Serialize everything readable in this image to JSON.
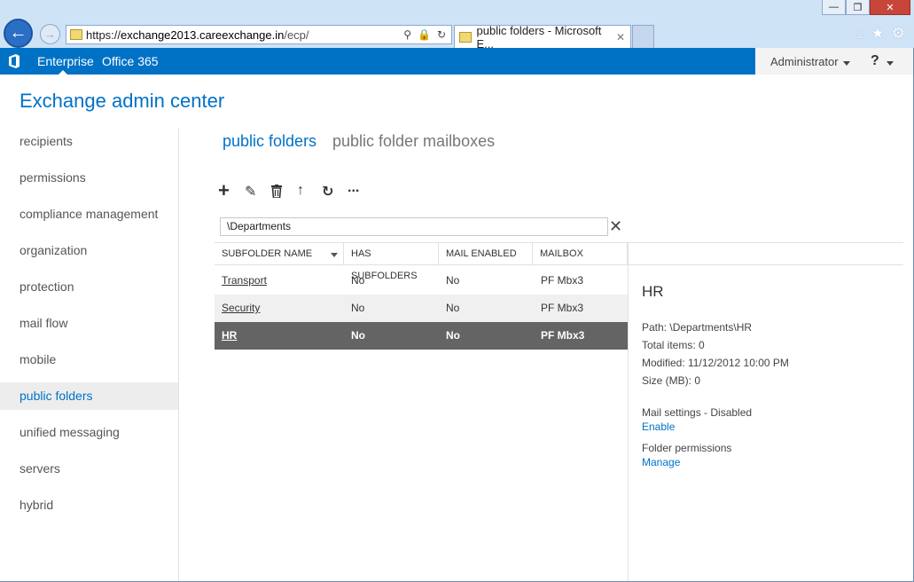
{
  "browser": {
    "window_buttons": {
      "minimize": "—",
      "restore": "❐",
      "close": "✕"
    },
    "address": {
      "host_prefix": "https://",
      "host": "exchange2013.careexchange.in",
      "path": "/ecp/"
    },
    "tab": {
      "title": "public folders - Microsoft E...",
      "close": "✕"
    },
    "toolbar_icons": [
      "home-icon",
      "star-icon",
      "gear-icon"
    ]
  },
  "suite": {
    "enterprise": "Enterprise",
    "office365": "Office 365",
    "user": "Administrator",
    "help": "?"
  },
  "app_title": "Exchange admin center",
  "nav": [
    "recipients",
    "permissions",
    "compliance management",
    "organization",
    "protection",
    "mail flow",
    "mobile",
    "public folders",
    "unified messaging",
    "servers",
    "hybrid"
  ],
  "active_nav": "public folders",
  "subtabs": {
    "active": "public folders",
    "other": "public folder mailboxes"
  },
  "toolbar": {
    "add": "+",
    "edit": "✎",
    "delete": "🗑",
    "up": "↑",
    "refresh": "↻",
    "more": "..."
  },
  "search": {
    "value": "\\Departments"
  },
  "table": {
    "columns": [
      "SUBFOLDER NAME",
      "HAS SUBFOLDERS",
      "MAIL ENABLED",
      "MAILBOX"
    ],
    "rows": [
      [
        "Transport",
        "No",
        "No",
        "PF Mbx3"
      ],
      [
        "Security",
        "No",
        "No",
        "PF Mbx3"
      ],
      [
        "HR",
        "No",
        "No",
        "PF Mbx3"
      ]
    ],
    "selected_index": 2
  },
  "details": {
    "title": "HR",
    "path": "Path: \\Departments\\HR",
    "total_items": "Total items: 0",
    "modified": "Modified: 11/12/2012 10:00 PM",
    "size": "Size (MB): 0",
    "mail_settings": "Mail settings - Disabled",
    "enable_link": "Enable",
    "folder_permissions": "Folder permissions",
    "manage_link": "Manage"
  },
  "colors": {
    "accent": "#0072c6",
    "selected_row": "#646464",
    "alt_row": "#f0f0f0"
  }
}
